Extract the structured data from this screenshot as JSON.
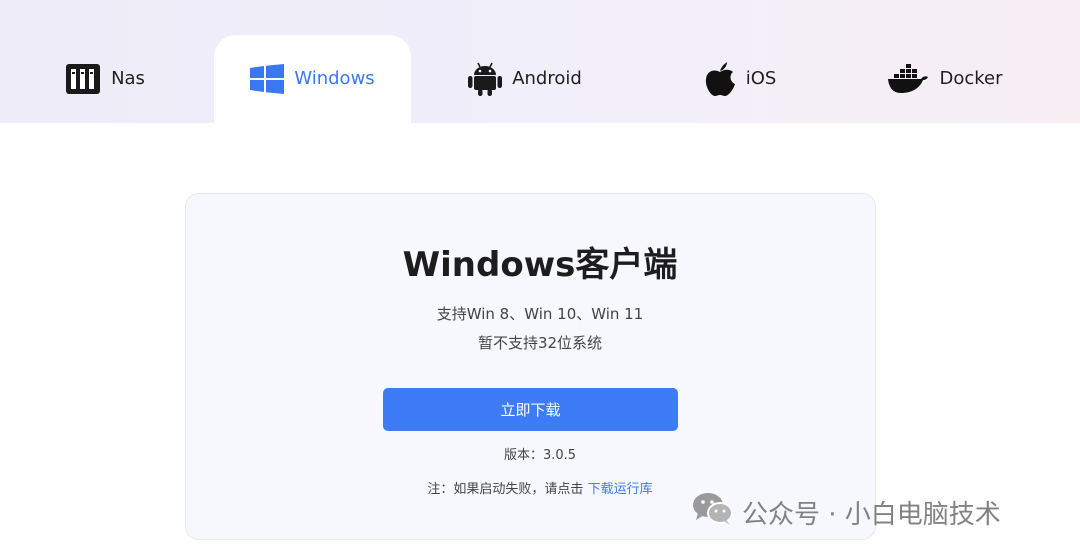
{
  "tabs": [
    {
      "label": "Nas",
      "icon": "nas-server-icon",
      "active": false
    },
    {
      "label": "Windows",
      "icon": "windows-logo-icon",
      "active": true
    },
    {
      "label": "Android",
      "icon": "android-robot-icon",
      "active": false
    },
    {
      "label": "iOS",
      "icon": "apple-logo-icon",
      "active": false
    },
    {
      "label": "Docker",
      "icon": "docker-whale-icon",
      "active": false
    }
  ],
  "card": {
    "title": "Windows客户端",
    "support_line_1": "支持Win 8、Win 10、Win 11",
    "support_line_2": "暂不支持32位系统",
    "download_label": "立即下载",
    "version": "版本：3.0.5",
    "note_prefix": "注：如果启动失败，请点击 ",
    "note_link": "下载运行库"
  },
  "watermark": {
    "text": "公众号 · 小白电脑技术",
    "icon": "wechat-icon"
  },
  "colors": {
    "accent": "#3d7bf7",
    "active_tab_text": "#3a78f2",
    "card_bg": "#f6f8fd"
  }
}
